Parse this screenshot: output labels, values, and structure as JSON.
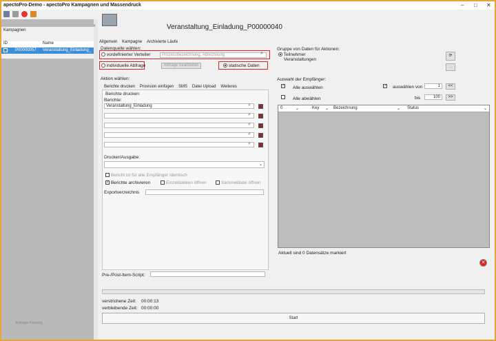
{
  "window": {
    "title": "apectoPro-Demo - apectoPro Kampagnen und Massendruck",
    "min": "–",
    "max": "□",
    "close": "✕"
  },
  "left": {
    "label": "Kampagnen",
    "columns": [
      "ID",
      "Name"
    ],
    "row": {
      "id": "P00000057",
      "name": "Veranstaltung_Einladung_"
    },
    "footer": "Anfrage-Katalog"
  },
  "main": {
    "title": "Veranstaltung_Einladung_P00000040",
    "tabs": [
      "Allgemein",
      "Kampagne",
      "Archivierte Läufe"
    ],
    "datasource_label": "Datenquelle wählen:",
    "radio_predefined": "vordefinierter Verteiler",
    "predefined_placeholder": "Prozessbezeichnung, Abrechnung",
    "radio_individual": "individuelle Abfrage",
    "btn_edit_query": "Abfrage bearbeiten",
    "radio_static": "statische Daten",
    "action_label": "Aktion wählen:",
    "action_tabs": [
      "Berichte drucken",
      "Provision einfügen",
      "SMS",
      "Datei Upload",
      "Weiteres"
    ],
    "print_label": "Berichte drucken:",
    "reports_label": "Berichte:",
    "report1": "Veranstaltung_Einladung",
    "printer_label": "Drucker/Ausgabe:",
    "identical_label": "Bericht ist für alle Empfänger identisch",
    "archive_label": "Berichte archivieren",
    "single_files_label": "Einzeldateien öffnen",
    "collective_label": "Sammeldatei öffnen",
    "export_label": "Exportverzeichnis",
    "script_label": "Pre-/Post-Item-Script:",
    "elapsed_label": "verstrichene Zeit:",
    "elapsed_value": "00:00:13",
    "remaining_label": "verbleibende Zeit:",
    "remaining_value": "00:00:00",
    "start_button": "Start"
  },
  "right": {
    "group_label": "Gruppe von Daten für Aktionen:",
    "group_radio1": "Teilnehmer",
    "group_radio2": "Veranstaltungen",
    "recipients_label": "Auswahl der Empfänger:",
    "select_all": "Alle auswählen",
    "deselect_all": "Alle abwählen",
    "select_from": "auswählen von",
    "from_value": "1",
    "to_label": "bis",
    "to_value": "100",
    "prev_btn": "<<",
    "next_btn": ">>",
    "grid_columns": [
      "0",
      "Key",
      "Bezeichnung",
      "Status"
    ],
    "status_text": "Aktuell sind 0 Datensätze markiert"
  }
}
